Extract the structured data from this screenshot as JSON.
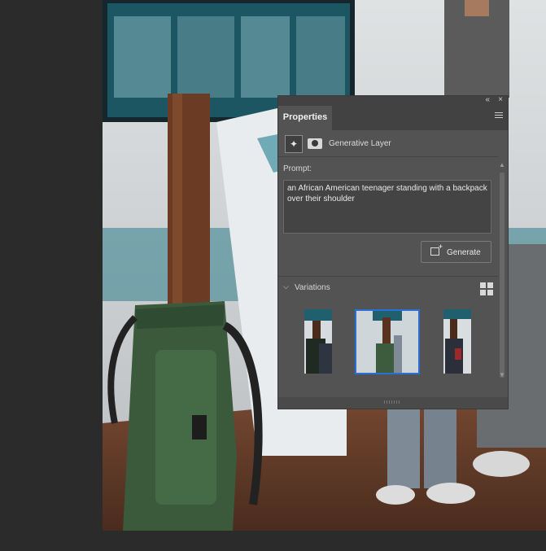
{
  "panel": {
    "tab_label": "Properties",
    "collapse_glyph": "«",
    "close_glyph": "×",
    "layer": {
      "icon": "generative-layer-icon",
      "name": "Generative Layer"
    },
    "prompt": {
      "label": "Prompt:",
      "value": "an African American teenager standing with a backpack over their shoulder"
    },
    "generate_button": "Generate",
    "variations": {
      "chevron": "⌵",
      "label": "Variations",
      "selected_index": 1,
      "count": 3
    }
  },
  "colors": {
    "panel_bg": "#535353",
    "panel_header": "#424242",
    "canvas_bg": "#2b2b2b",
    "selection": "#2a6ed8"
  }
}
